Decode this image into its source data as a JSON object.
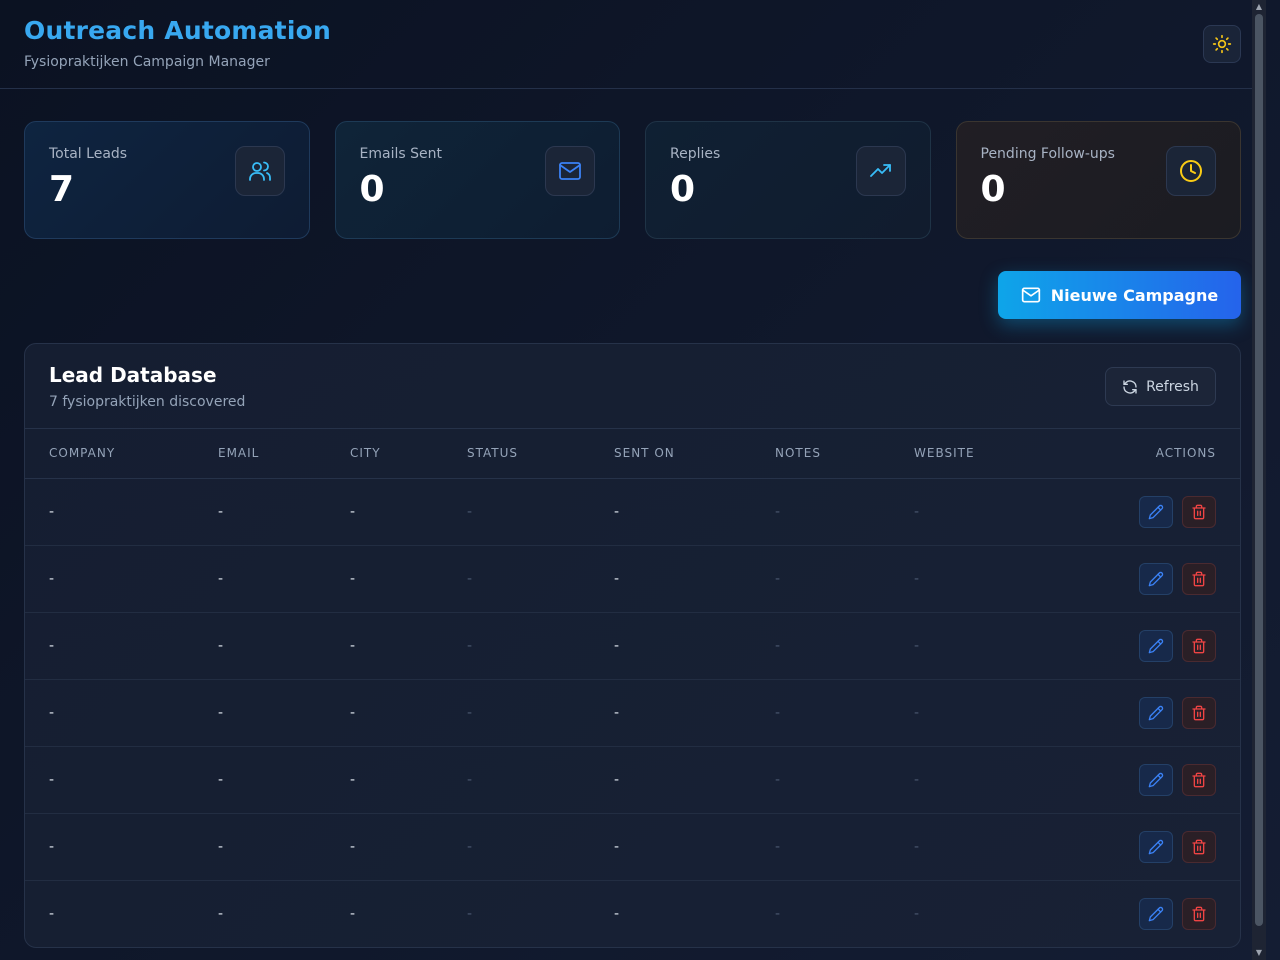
{
  "header": {
    "title": "Outreach Automation",
    "subtitle": "Fysiopraktijken Campaign Manager",
    "theme_icon": "sun-icon"
  },
  "stats": [
    {
      "label": "Total Leads",
      "value": "7",
      "icon": "users-icon",
      "icon_color": "#38bdf8"
    },
    {
      "label": "Emails Sent",
      "value": "0",
      "icon": "mail-icon",
      "icon_color": "#3b82f6"
    },
    {
      "label": "Replies",
      "value": "0",
      "icon": "trending-up-icon",
      "icon_color": "#38bdf8"
    },
    {
      "label": "Pending Follow-ups",
      "value": "0",
      "icon": "clock-icon",
      "icon_color": "#facc15"
    }
  ],
  "actions": {
    "new_campaign_label": "Nieuwe Campagne"
  },
  "lead_panel": {
    "title": "Lead Database",
    "subtitle": "7 fysiopraktijken discovered",
    "refresh_label": "Refresh",
    "columns": [
      "COMPANY",
      "EMAIL",
      "CITY",
      "STATUS",
      "SENT ON",
      "NOTES",
      "WEBSITE",
      "ACTIONS"
    ],
    "rows": [
      {
        "company": "-",
        "email": "-",
        "city": "-",
        "status": "-",
        "sent_on": "-",
        "notes": "-",
        "website": "-"
      },
      {
        "company": "-",
        "email": "-",
        "city": "-",
        "status": "-",
        "sent_on": "-",
        "notes": "-",
        "website": "-"
      },
      {
        "company": "-",
        "email": "-",
        "city": "-",
        "status": "-",
        "sent_on": "-",
        "notes": "-",
        "website": "-"
      },
      {
        "company": "-",
        "email": "-",
        "city": "-",
        "status": "-",
        "sent_on": "-",
        "notes": "-",
        "website": "-"
      },
      {
        "company": "-",
        "email": "-",
        "city": "-",
        "status": "-",
        "sent_on": "-",
        "notes": "-",
        "website": "-"
      },
      {
        "company": "-",
        "email": "-",
        "city": "-",
        "status": "-",
        "sent_on": "-",
        "notes": "-",
        "website": "-"
      },
      {
        "company": "-",
        "email": "-",
        "city": "-",
        "status": "-",
        "sent_on": "-",
        "notes": "-",
        "website": "-"
      }
    ]
  },
  "colors": {
    "accent": "#38a8f0",
    "edit": "#3b82f6",
    "delete": "#ef4444"
  }
}
